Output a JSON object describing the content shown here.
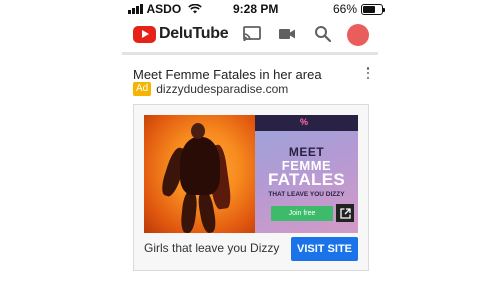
{
  "status_bar": {
    "carrier": "ASDO",
    "time": "9:28 PM",
    "battery_percent": "66%",
    "battery_level": 0.66
  },
  "app_bar": {
    "logo_text": "DeluTube",
    "icons": [
      "cast-icon",
      "video-camera-icon",
      "search-icon",
      "avatar"
    ],
    "brand_color": "#e62117",
    "avatar_color": "#e95e5c"
  },
  "ad": {
    "title": "Meet Femme Fatales in her area",
    "badge": "Ad",
    "domain": "dizzydudesparadise.com",
    "banner": {
      "heading_1": "MEET",
      "heading_2": "FEMME",
      "heading_3": "FATALES",
      "subheading": "THAT LEAVE YOU DIZZY",
      "join_label": "Join free"
    },
    "cta_text": "Girls that leave you Dizzy",
    "visit_label": "VISIT SITE",
    "badge_color": "#f4b400",
    "visit_color": "#1a73e8"
  }
}
